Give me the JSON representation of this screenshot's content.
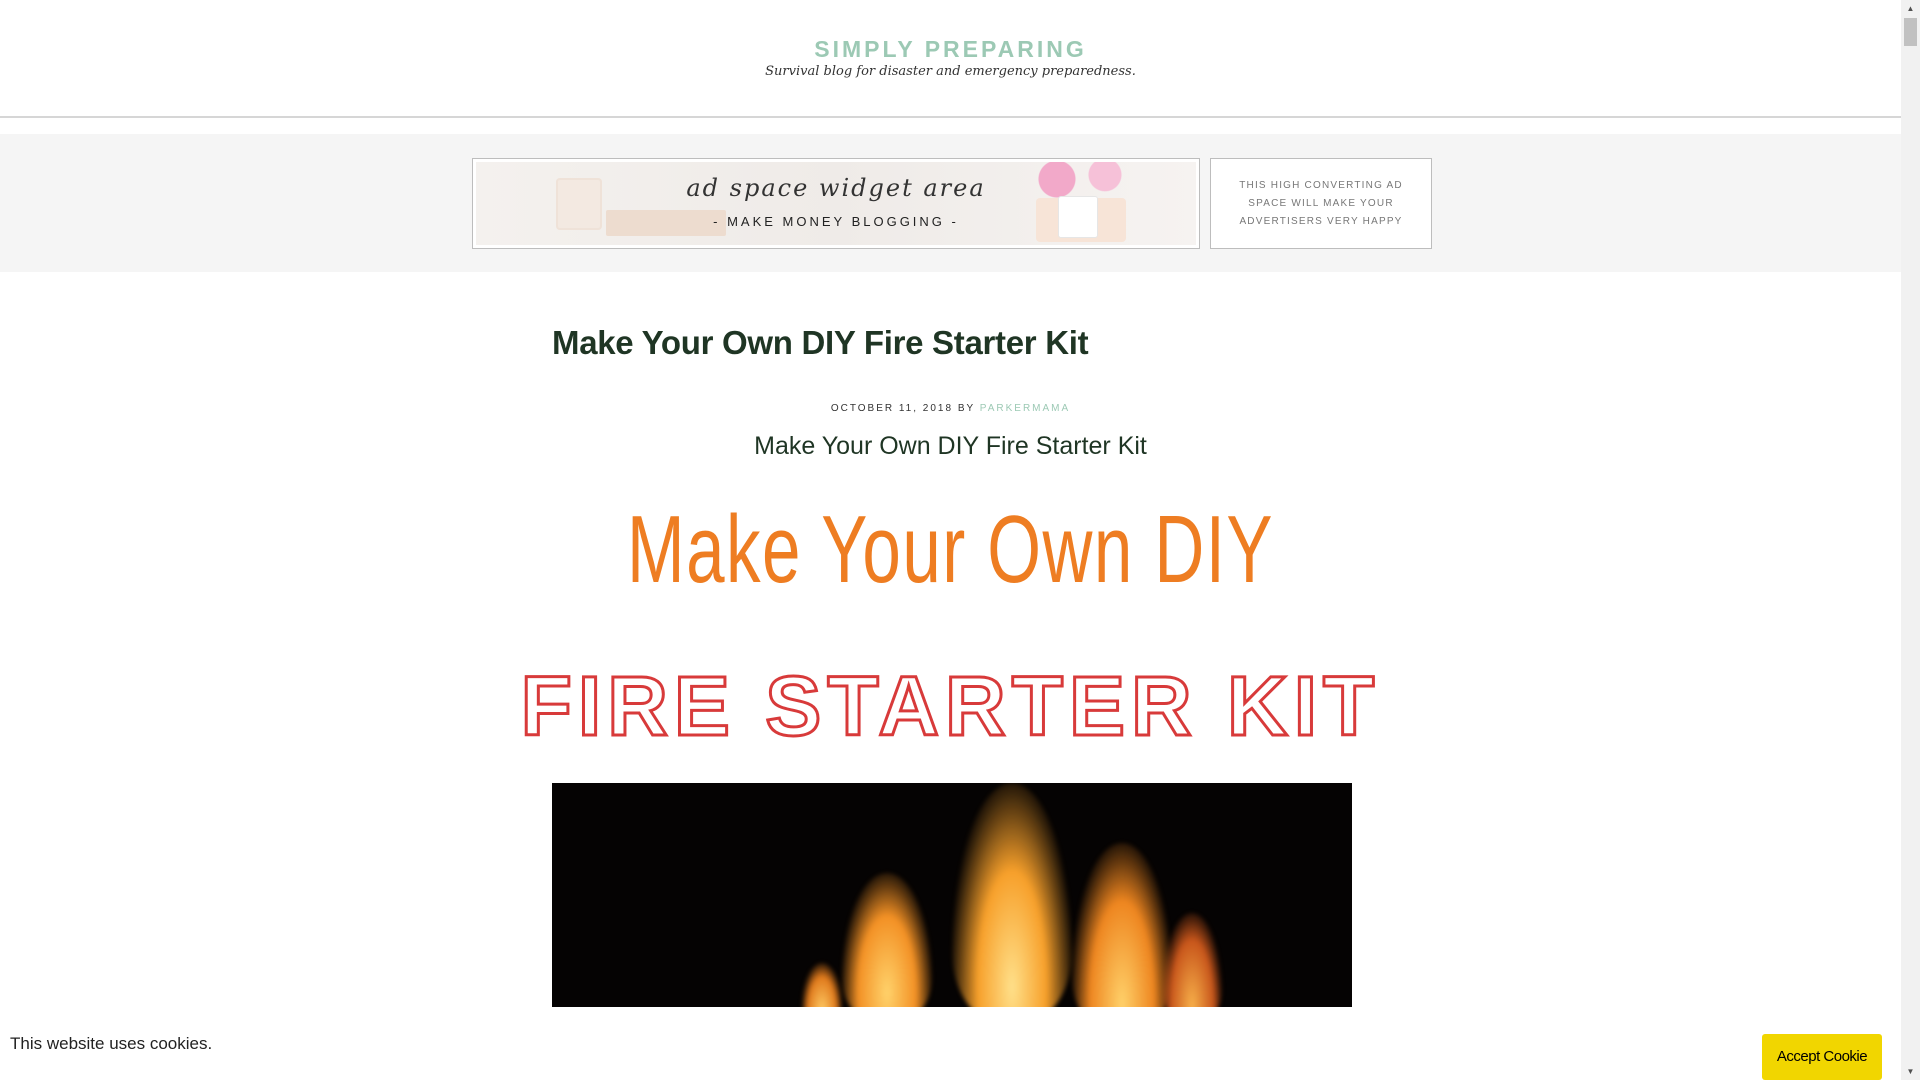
{
  "header": {
    "site_title": "SIMPLY PREPARING",
    "site_description": "Survival blog for disaster and emergency preparedness."
  },
  "ads": {
    "wide": {
      "script_text": "ad space widget area",
      "sub_text": "- MAKE MONEY BLOGGING -"
    },
    "small": {
      "text": "THIS HIGH CONVERTING AD SPACE WILL MAKE YOUR ADVERTISERS VERY HAPPY"
    }
  },
  "article": {
    "title": "Make Your Own DIY Fire Starter Kit",
    "meta_date": "OCTOBER 11, 2018",
    "meta_by": "BY",
    "meta_author": "PARKERMAMA",
    "subtitle": "Make Your Own DIY Fire Starter Kit",
    "hero_line_1": "Make Your Own DIY",
    "hero_line_2": "FIRE STARTER KIT"
  },
  "cookie": {
    "message": "This website uses cookies.",
    "accept_label": "Accept Cookie"
  },
  "scrollbar": {
    "up_icon": "▲",
    "down_icon": "▼"
  },
  "colors": {
    "brand": "#9cc9b4",
    "title": "#1f3524",
    "hero_orange": "#ee7d22",
    "hero_red": "#d83a3a",
    "cookie_button": "#f1d600"
  }
}
